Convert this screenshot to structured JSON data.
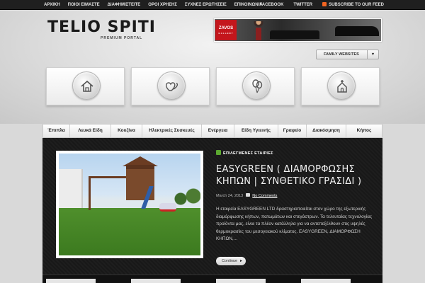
{
  "topbar": {
    "left_links": [
      "ΑΡΧΙΚΗ",
      "ΠΟΙΟΙ ΕΙΜΑΣΤΕ",
      "ΔΙΑΦΗΜΙΣΤΕΙΤΕ",
      "ΟΡΟΙ ΧΡΗΣΗΣ",
      "ΣΥΧΝΕΣ ΕΡΩΤΗΣΕΙΣ",
      "ΕΠΙΚΟΙΝΩΝΙΑ"
    ],
    "right_links": [
      "FACEBOOK",
      "TWITTER",
      "SUBSCRIBE TO OUR FEED"
    ]
  },
  "header": {
    "logo": "TELIO SPITI",
    "tagline": "PREMIUM PORTAL",
    "ad_brand": "ZAVOS",
    "ad_brand_sub": "GALLERY",
    "family_button": "FAMILY WEBSITES"
  },
  "features": [
    {
      "icon": "house-icon"
    },
    {
      "icon": "hearts-icon"
    },
    {
      "icon": "balloons-icon"
    },
    {
      "icon": "church-icon"
    }
  ],
  "main_nav": [
    "Έπιπλα",
    "Λευκά Είδη",
    "Κουζίνα",
    "Ηλεκτρικές Συσκευές",
    "Ενέργεια",
    "Είδη Υγιεινής",
    "Γραφείο",
    "Διακόσμηση",
    "Κήπος"
  ],
  "post": {
    "category": "ΕΠΙΛΕΓΜΕΝΕΣ ΕΤΑΙΡΙΕΣ",
    "title": "EASYGREEN ( ΔΙΑΜΟΡΦΩΣΗΣ ΚΗΠΩΝ | ΣΥΝΘΕΤΙΚΟ ΓΡΑΣΙΔΙ )",
    "date": "March 24, 2013",
    "comments": "No Comments",
    "excerpt": "Η εταιρεία EASYGREEN LTD δραστηριοποιείται στον χώρο της εξωτερικής διαμόρφωσης κήπων, πατωμάτων και στεγάστρων. Τα τελευταίας τεχνολογίας προϊόντα μας, είναι τα πλέον κατάλληλα για να αντεπεξέλθουν στις υψηλές θερμοκρασίες του μεσογειακού κλίματος. EASYGREEN, ΔΙΑΜΟΡΦΩΣΗ ΚΗΠΩΝ,...",
    "continue": "Continue"
  }
}
